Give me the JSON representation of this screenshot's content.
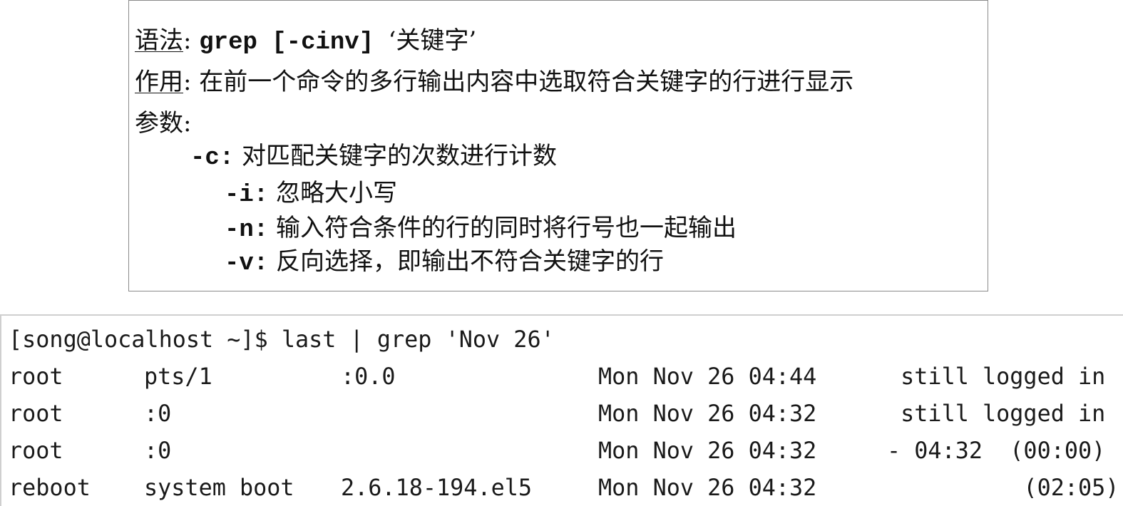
{
  "doc": {
    "syntax_label": "语法",
    "syntax_sep": ": ",
    "syntax_cmd": "grep [-cinv] ",
    "syntax_arg": "‘关键字’",
    "purpose_label": "作用",
    "purpose_sep": ": ",
    "purpose_text": "在前一个命令的多行输出内容中选取符合关键字的行进行显示",
    "params_label": "参数:",
    "params": [
      {
        "flag": "-c:",
        "desc": " 对匹配关键字的次数进行计数"
      },
      {
        "flag": "-i:",
        "desc": " 忽略大小写"
      },
      {
        "flag": "-n:",
        "desc": " 输入符合条件的行的同时将行号也一起输出"
      },
      {
        "flag": "-v:",
        "desc": " 反向选择，即输出不符合关键字的行"
      }
    ]
  },
  "terminal": {
    "prompt_line": "[song@localhost ~]$ last | grep 'Nov 26'",
    "rows": [
      {
        "user": "root",
        "tty": "pts/1",
        "host": ":0.0",
        "date": "Mon Nov 26 04:44",
        "duration": " still logged in"
      },
      {
        "user": "root",
        "tty": ":0",
        "host": "",
        "date": "Mon Nov 26 04:32",
        "duration": " still logged in"
      },
      {
        "user": "root",
        "tty": ":0",
        "host": "",
        "date": "Mon Nov 26 04:32",
        "duration": "- 04:32  (00:00)"
      },
      {
        "user": "reboot",
        "tty": "system boot",
        "host": "2.6.18-194.el5",
        "date": "Mon Nov 26 04:32",
        "duration": "          (02:05)"
      }
    ]
  }
}
